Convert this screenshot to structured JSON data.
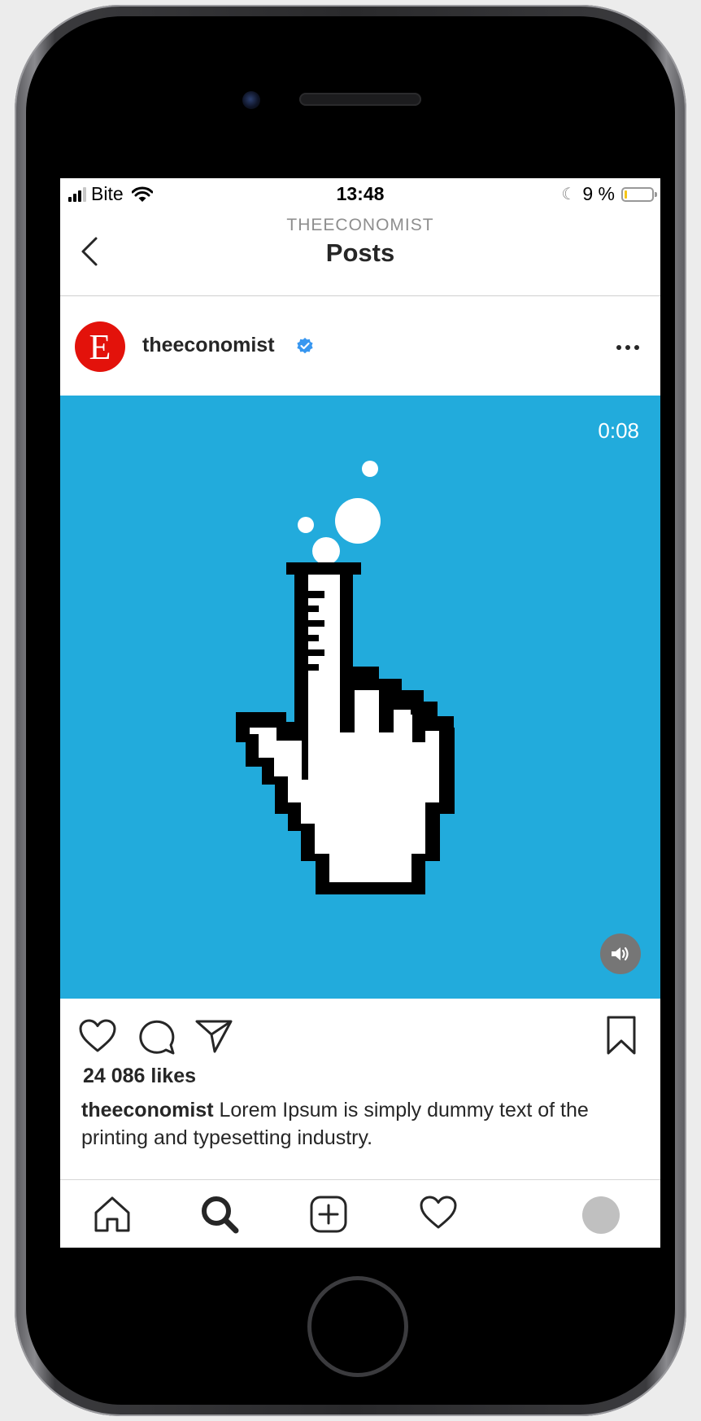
{
  "status_bar": {
    "carrier": "Bite",
    "time": "13:48",
    "battery_text": "9 %",
    "battery_level": 0.09
  },
  "header": {
    "account_label": "THEECONOMIST",
    "title": "Posts"
  },
  "post": {
    "avatar_letter": "E",
    "username": "theeconomist",
    "video_time": "0:08",
    "likes": "24 086 likes",
    "caption_user": "theeconomist",
    "caption_text": "Lorem Ipsum is simply dummy text of the printing and typesetting industry."
  },
  "colors": {
    "media_background": "#22abdc",
    "brand_red": "#e3120b",
    "verified_blue": "#3897f0"
  },
  "icons": {
    "status": [
      "signal-icon",
      "wifi-icon",
      "moon-icon",
      "battery-icon"
    ],
    "header": [
      "back-arrow-icon"
    ],
    "post": [
      "verified-icon",
      "more-icon",
      "mute-icon"
    ],
    "actions": [
      "heart-icon",
      "comment-icon",
      "share-icon",
      "bookmark-icon"
    ],
    "tabs": [
      "home-icon",
      "search-icon",
      "add-post-icon",
      "activity-heart-icon",
      "profile-avatar"
    ]
  }
}
